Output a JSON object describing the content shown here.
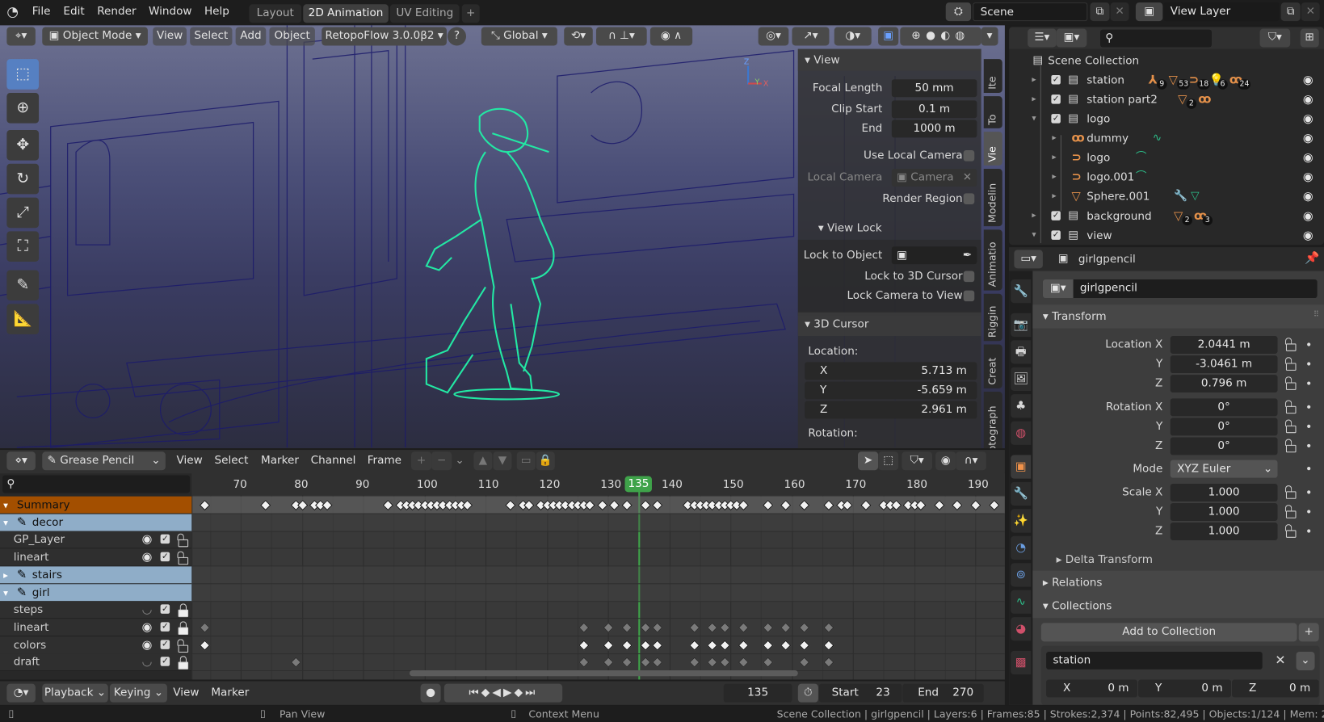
{
  "topbar": {
    "menus": [
      "File",
      "Edit",
      "Render",
      "Window",
      "Help"
    ],
    "workspace_tabs": [
      "Layout",
      "2D Animation",
      "UV Editing"
    ],
    "active_tab": "2D Animation",
    "add_tab": "+",
    "scene": "Scene",
    "view_layer": "View Layer"
  },
  "viewport": {
    "mode": "Object Mode",
    "menus": [
      "View",
      "Select",
      "Add",
      "Object"
    ],
    "addon": "RetopoFlow 3.0.0β2",
    "help": "?",
    "orientation": "Global",
    "gizmo_axes": [
      "Z",
      "Y",
      "X"
    ],
    "npanel": {
      "tabs": [
        "Ite",
        "To",
        "Vie",
        "Modelin",
        "Animatio",
        "Riggin",
        "Creat",
        "Photograph"
      ],
      "view_header": "View",
      "focal_length_label": "Focal Length",
      "focal_length": "50 mm",
      "clip_start_label": "Clip Start",
      "clip_start": "0.1 m",
      "clip_end_label": "End",
      "clip_end": "1000 m",
      "use_local_camera": "Use Local Camera",
      "local_camera_label": "Local Camera",
      "local_camera": "Camera",
      "render_region": "Render Region",
      "view_lock_header": "View Lock",
      "lock_to_object": "Lock to Object",
      "lock_to_cursor": "Lock to 3D Cursor",
      "lock_camera": "Lock Camera to View",
      "cursor_header": "3D Cursor",
      "location_label": "Location:",
      "cursor_x": "5.713 m",
      "cursor_y": "-5.659 m",
      "cursor_z": "2.961 m",
      "rotation_label": "Rotation:",
      "axes": [
        "X",
        "Y",
        "Z"
      ]
    }
  },
  "outliner": {
    "root": "Scene Collection",
    "items": [
      {
        "name": "station",
        "badges": [
          "9",
          "53",
          "18",
          "6",
          "24"
        ]
      },
      {
        "name": "station part2",
        "badges": [
          "2"
        ]
      },
      {
        "name": "logo",
        "badges": []
      },
      {
        "name": "dummy",
        "badges": []
      },
      {
        "name": "logo",
        "badges": []
      },
      {
        "name": "logo.001",
        "badges": []
      },
      {
        "name": "Sphere.001",
        "badges": []
      },
      {
        "name": "background",
        "badges": [
          "2",
          "3"
        ]
      },
      {
        "name": "view",
        "badges": []
      }
    ]
  },
  "properties": {
    "object_name": "girlgpencil",
    "name_field": "girlgpencil",
    "transform_header": "Transform",
    "location_label": "Location X",
    "location": [
      "2.0441 m",
      "-3.0461 m",
      "0.796 m"
    ],
    "rotation_label": "Rotation X",
    "rotation": [
      "0°",
      "0°",
      "0°"
    ],
    "mode_label": "Mode",
    "mode": "XYZ Euler",
    "scale_label": "Scale X",
    "scale": [
      "1.000",
      "1.000",
      "1.000"
    ],
    "axis_labels": [
      "Y",
      "Z"
    ],
    "delta_transform": "Delta Transform",
    "relations": "Relations",
    "collections": "Collections",
    "add_to_collection": "Add to Collection",
    "collection_name": "station",
    "offset": {
      "x_label": "X",
      "x": "0 m",
      "y_label": "Y",
      "y": "0 m",
      "z_label": "Z",
      "z": "0 m"
    }
  },
  "dopesheet": {
    "mode": "Grease Pencil",
    "menus": [
      "View",
      "Select",
      "Marker",
      "Channel",
      "Frame"
    ],
    "current_frame": 135,
    "ruler": [
      70,
      80,
      90,
      100,
      110,
      120,
      130,
      140,
      150,
      160,
      170,
      180,
      190
    ],
    "channels": [
      {
        "name": "Summary",
        "type": "summary"
      },
      {
        "name": "decor",
        "type": "group"
      },
      {
        "name": "GP_Layer",
        "type": "layer",
        "visible": true,
        "locked": false
      },
      {
        "name": "lineart",
        "type": "layer",
        "visible": true,
        "locked": false
      },
      {
        "name": "stairs",
        "type": "group"
      },
      {
        "name": "girl",
        "type": "group"
      },
      {
        "name": "steps",
        "type": "layer",
        "visible": false,
        "locked": true
      },
      {
        "name": "lineart",
        "type": "layer",
        "visible": true,
        "locked": true
      },
      {
        "name": "colors",
        "type": "layer",
        "visible": true,
        "locked": false
      },
      {
        "name": "draft",
        "type": "layer",
        "visible": false,
        "locked": true
      }
    ],
    "keyframes": {
      "summary": [
        64,
        74,
        79,
        80,
        82,
        83,
        84,
        94,
        96,
        97,
        98,
        99,
        100,
        101,
        102,
        103,
        104,
        105,
        106,
        107,
        114,
        116,
        117,
        119,
        120,
        121,
        122,
        123,
        124,
        125,
        126,
        127,
        129,
        131,
        133,
        136,
        138,
        143,
        144,
        145,
        146,
        147,
        148,
        149,
        150,
        151,
        152,
        156,
        159,
        162,
        166,
        168,
        169,
        172,
        175,
        176,
        177,
        179,
        180,
        181,
        184,
        187,
        190,
        193
      ],
      "lineart": [
        64,
        126,
        130,
        133,
        136,
        138,
        144,
        147,
        149,
        152,
        156,
        159,
        162,
        166
      ],
      "colors": [
        64,
        126,
        130,
        133,
        136,
        138,
        144,
        147,
        149,
        152,
        156,
        159,
        162,
        166
      ],
      "draft": [
        79,
        126,
        130,
        133,
        136,
        138,
        144,
        147,
        149,
        152,
        156,
        162,
        166
      ]
    }
  },
  "timeline": {
    "menus": [
      "Playback",
      "Keying",
      "View",
      "Marker"
    ],
    "frame": "135",
    "start_label": "Start",
    "start": "23",
    "end_label": "End",
    "end": "270"
  },
  "statusbar": {
    "pan": "Pan View",
    "context": "Context Menu",
    "stats": "Scene Collection | girlgpencil | Layers:6 | Frames:85 | Strokes:2,374 | Points:82,495 | Objects:1/124 | Mem: 2"
  },
  "colors": {
    "accent": "#e5914a",
    "summary": "#a34f00",
    "group": "#8fadc8",
    "playhead": "#3fa34a",
    "stroke": "#23e8a4"
  }
}
